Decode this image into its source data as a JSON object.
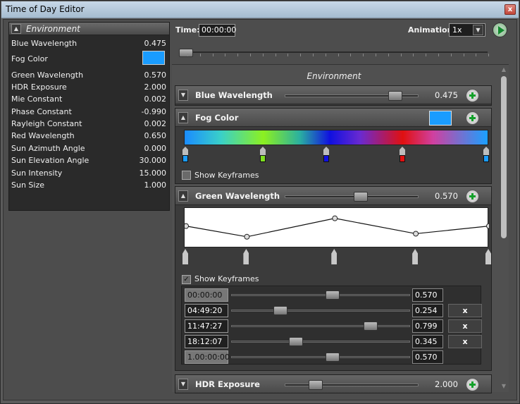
{
  "window": {
    "title": "Time of Day Editor",
    "close_glyph": "x"
  },
  "left_panel": {
    "header": "Environment",
    "properties": [
      {
        "name": "Blue Wavelength",
        "value": "0.475"
      },
      {
        "name": "Fog Color",
        "value": ""
      },
      {
        "name": "Green Wavelength",
        "value": "0.570"
      },
      {
        "name": "HDR Exposure",
        "value": "2.000"
      },
      {
        "name": "Mie Constant",
        "value": "0.002"
      },
      {
        "name": "Phase Constant",
        "value": "-0.990"
      },
      {
        "name": "Rayleigh Constant",
        "value": "0.002"
      },
      {
        "name": "Red Wavelength",
        "value": "0.650"
      },
      {
        "name": "Sun Azimuth Angle",
        "value": "0.000"
      },
      {
        "name": "Sun Elevation Angle",
        "value": "30.000"
      },
      {
        "name": "Sun Intensity",
        "value": "15.000"
      },
      {
        "name": "Sun Size",
        "value": "1.000"
      }
    ],
    "fog_color": "#1a9cff"
  },
  "toolbar": {
    "time_label": "Time:",
    "time_value": "00:00:00",
    "animation_label": "Animation:",
    "animation_value": "1x"
  },
  "environment": {
    "title": "Environment",
    "sections": {
      "blue": {
        "name": "Blue Wavelength",
        "value": "0.475",
        "level": 0.86
      },
      "fog": {
        "name": "Fog Color",
        "show_keyframes": "Show Keyframes",
        "show_keyframes_checked": false,
        "keyframe_colors": [
          "#1a9cff",
          "#7fe020",
          "#1010e0",
          "#e01010",
          "#1a9cff"
        ]
      },
      "green": {
        "name": "Green Wavelength",
        "value": "0.570",
        "level": 0.57,
        "show_keyframes": "Show Keyframes",
        "show_keyframes_checked": true,
        "keyframes": [
          {
            "time": "00:00:00",
            "value": "0.570",
            "removable": false
          },
          {
            "time": "04:49:20",
            "value": "0.254",
            "removable": true,
            "remove": "x"
          },
          {
            "time": "11:47:27",
            "value": "0.799",
            "removable": true,
            "remove": "x"
          },
          {
            "time": "18:12:07",
            "value": "0.345",
            "removable": true,
            "remove": "x"
          },
          {
            "time": "1.00:00:00",
            "value": "0.570",
            "removable": false
          }
        ]
      },
      "hdr": {
        "name": "HDR Exposure",
        "value": "2.000"
      }
    }
  },
  "colors": {
    "accent_green": "#12a02a",
    "fog_blue": "#1a9cff"
  }
}
